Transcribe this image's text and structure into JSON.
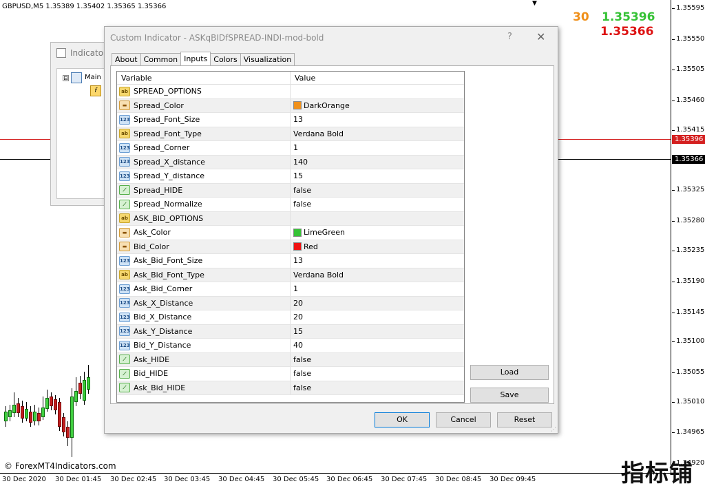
{
  "chart": {
    "header": "GBPUSD,M5  1.35389 1.35402 1.35365 1.35366",
    "arrow": "▼",
    "spread_value": "30",
    "ask_value": "1.35396",
    "bid_value": "1.35366",
    "copyright": "© ForexMT4Indicators.com",
    "ask_badge": "1.35396",
    "bid_badge": "1.35366",
    "colors": {
      "ask_line": "#d42020",
      "bid_line": "#000000",
      "spread": "#f0901a",
      "ask": "#36c236",
      "bid": "#dd1111"
    }
  },
  "price_axis": [
    "1.35595",
    "1.35550",
    "1.35505",
    "1.35460",
    "1.35415",
    "1.35325",
    "1.35280",
    "1.35235",
    "1.35190",
    "1.35145",
    "1.35100",
    "1.35055",
    "1.35010",
    "1.34965",
    "1.34920"
  ],
  "time_axis": [
    "30 Dec 2020",
    "30 Dec 01:45",
    "30 Dec 02:45",
    "30 Dec 03:45",
    "30 Dec 04:45",
    "30 Dec 05:45",
    "30 Dec 06:45",
    "30 Dec 07:45",
    "30 Dec 08:45",
    "30 Dec 09:45"
  ],
  "watermark": "指标铺",
  "indicators_window": {
    "title": "Indicato",
    "tree_main": "Main",
    "expander": "⊟"
  },
  "dialog": {
    "title": "Custom Indicator - ASKqBIDfSPREAD-INDI-mod-bold",
    "help": "?",
    "close": "✕",
    "tabs": [
      "About",
      "Common",
      "Inputs",
      "Colors",
      "Visualization"
    ],
    "active_tab": "Inputs",
    "columns": {
      "variable": "Variable",
      "value": "Value"
    },
    "rows": [
      {
        "type": "str",
        "icon": "ab",
        "name": "SPREAD_OPTIONS",
        "value": ""
      },
      {
        "type": "col",
        "icon": "",
        "name": "Spread_Color",
        "value": "DarkOrange",
        "swatch": "#f0901a"
      },
      {
        "type": "int",
        "icon": "123",
        "name": "Spread_Font_Size",
        "value": "13"
      },
      {
        "type": "str",
        "icon": "ab",
        "name": "Spread_Font_Type",
        "value": "Verdana Bold"
      },
      {
        "type": "int",
        "icon": "123",
        "name": "Spread_Corner",
        "value": "1"
      },
      {
        "type": "int",
        "icon": "123",
        "name": "Spread_X_distance",
        "value": "140"
      },
      {
        "type": "int",
        "icon": "123",
        "name": "Spread_Y_distance",
        "value": "15"
      },
      {
        "type": "bool",
        "icon": "",
        "name": "Spread_HIDE",
        "value": "false"
      },
      {
        "type": "bool",
        "icon": "",
        "name": "Spread_Normalize",
        "value": "false"
      },
      {
        "type": "str",
        "icon": "ab",
        "name": "ASK_BID_OPTIONS",
        "value": ""
      },
      {
        "type": "col",
        "icon": "",
        "name": "Ask_Color",
        "value": "LimeGreen",
        "swatch": "#36c236"
      },
      {
        "type": "col",
        "icon": "",
        "name": "Bid_Color",
        "value": "Red",
        "swatch": "#ee1111"
      },
      {
        "type": "int",
        "icon": "123",
        "name": "Ask_Bid_Font_Size",
        "value": "13"
      },
      {
        "type": "str",
        "icon": "ab",
        "name": "Ask_Bid_Font_Type",
        "value": "Verdana Bold"
      },
      {
        "type": "int",
        "icon": "123",
        "name": "Ask_Bid_Corner",
        "value": "1"
      },
      {
        "type": "int",
        "icon": "123",
        "name": "Ask_X_Distance",
        "value": "20"
      },
      {
        "type": "int",
        "icon": "123",
        "name": "Bid_X_Distance",
        "value": "20"
      },
      {
        "type": "int",
        "icon": "123",
        "name": "Ask_Y_Distance",
        "value": "15"
      },
      {
        "type": "int",
        "icon": "123",
        "name": "Bid_Y_Distance",
        "value": "40"
      },
      {
        "type": "bool",
        "icon": "",
        "name": "Ask_HIDE",
        "value": "false"
      },
      {
        "type": "bool",
        "icon": "",
        "name": "Bid_HIDE",
        "value": "false"
      },
      {
        "type": "bool",
        "icon": "",
        "name": "Ask_Bid_HIDE",
        "value": "false"
      }
    ],
    "buttons": {
      "load": "Load",
      "save": "Save",
      "ok": "OK",
      "cancel": "Cancel",
      "reset": "Reset"
    }
  }
}
